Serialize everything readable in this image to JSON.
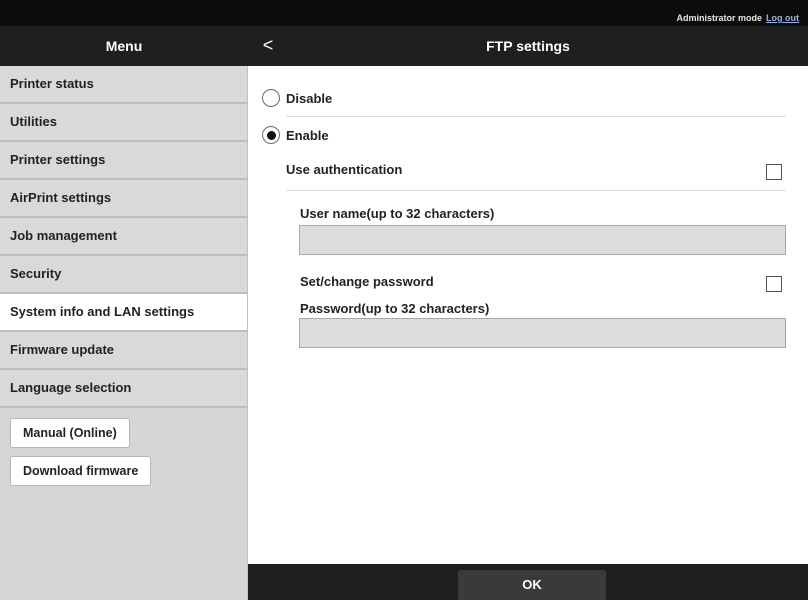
{
  "topbar": {
    "mode_text": "Administrator mode",
    "logout_label": "Log out"
  },
  "header": {
    "menu_title": "Menu",
    "back_label": "<",
    "page_title": "FTP settings"
  },
  "sidebar": {
    "items": [
      {
        "label": "Printer status",
        "active": false
      },
      {
        "label": "Utilities",
        "active": false
      },
      {
        "label": "Printer settings",
        "active": false
      },
      {
        "label": "AirPrint settings",
        "active": false
      },
      {
        "label": "Job management",
        "active": false
      },
      {
        "label": "Security",
        "active": false
      },
      {
        "label": "System info and LAN settings",
        "active": true
      },
      {
        "label": "Firmware update",
        "active": false
      },
      {
        "label": "Language selection",
        "active": false
      }
    ],
    "buttons": [
      {
        "label": "Manual (Online)"
      },
      {
        "label": "Download firmware"
      }
    ]
  },
  "ftp": {
    "disable_label": "Disable",
    "enable_label": "Enable",
    "selected": "Enable",
    "use_auth_label": "Use authentication",
    "use_auth_checked": false,
    "username_label": "User name(up to 32 characters)",
    "username_value": "",
    "set_password_label": "Set/change password",
    "set_password_checked": false,
    "password_label": "Password(up to 32 characters)",
    "password_value": ""
  },
  "footer": {
    "ok_label": "OK"
  },
  "colors": {
    "topbar": "#0c0c0c",
    "header": "#1f1f1f",
    "sidebar": "#d6d6d6",
    "active_item": "#ffffff",
    "footer": "#1e1e1e",
    "ok_button": "#3a3a3a",
    "link": "#9bb3e6"
  }
}
